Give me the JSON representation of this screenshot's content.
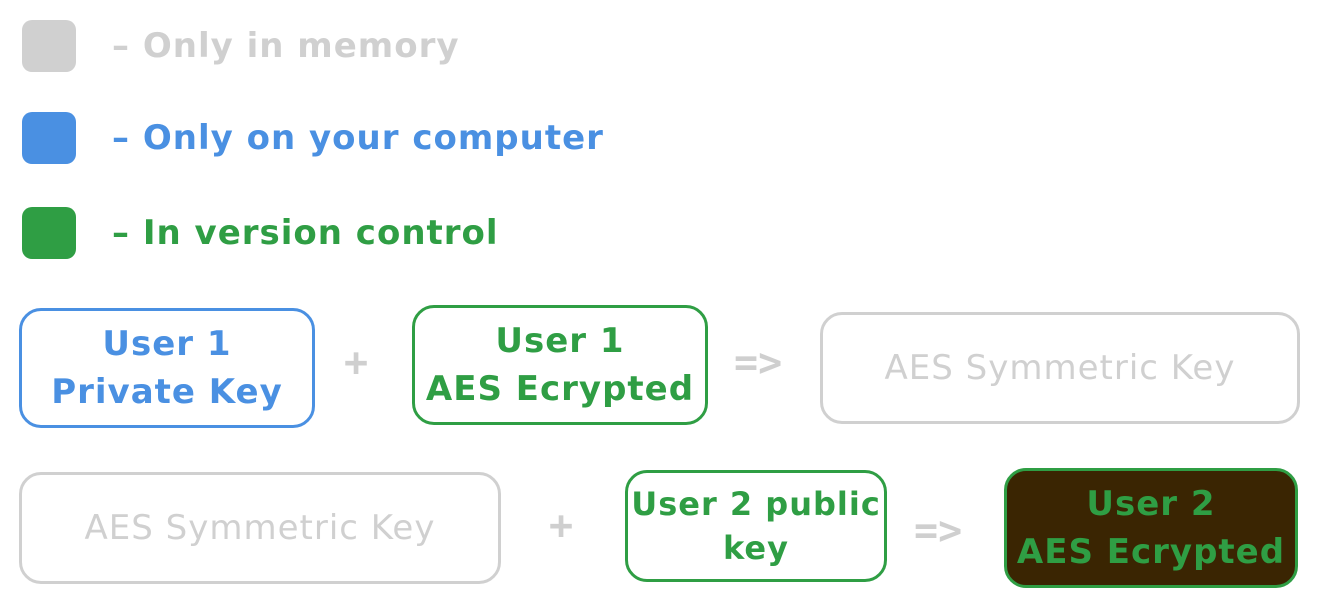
{
  "colors": {
    "memory": "#d0d0d0",
    "computer": "#4a90e2",
    "version_control": "#2f9e44",
    "result_fill": "#3a2502"
  },
  "legend": [
    {
      "key": "memory",
      "label": "– Only in memory"
    },
    {
      "key": "computer",
      "label": "– Only on your computer"
    },
    {
      "key": "version_control",
      "label": "– In version control"
    }
  ],
  "row1": {
    "box1": "User 1\nPrivate Key",
    "plus": "+",
    "box2": "User 1\nAES Ecrypted",
    "arrow": "=>",
    "result": "AES Symmetric Key"
  },
  "row2": {
    "box1": "AES Symmetric Key",
    "plus": "+",
    "box2": "User 2 public\nkey",
    "arrow": "=>",
    "result": "User 2\nAES Ecrypted"
  }
}
